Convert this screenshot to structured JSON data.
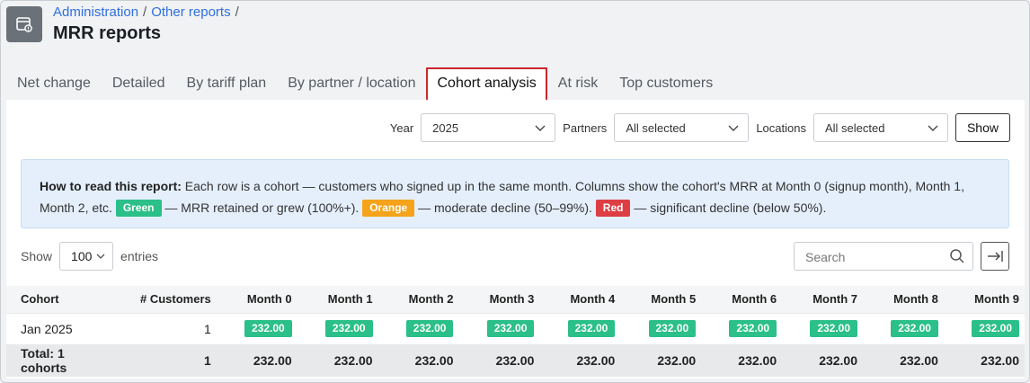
{
  "breadcrumb": {
    "items": [
      "Administration",
      "Other reports"
    ],
    "separator": "/"
  },
  "page_title": "MRR reports",
  "tabs": [
    {
      "label": "Net change"
    },
    {
      "label": "Detailed"
    },
    {
      "label": "By tariff plan"
    },
    {
      "label": "By partner / location"
    },
    {
      "label": "Cohort analysis",
      "active": true
    },
    {
      "label": "At risk"
    },
    {
      "label": "Top customers"
    }
  ],
  "filters": {
    "year_label": "Year",
    "year_value": "2025",
    "partners_label": "Partners",
    "partners_value": "All selected",
    "locations_label": "Locations",
    "locations_value": "All selected",
    "show_button": "Show"
  },
  "info": {
    "heading": "How to read this report:",
    "text1": " Each row is a cohort — customers who signed up in the same month. Columns show the cohort's MRR at Month 0 (signup month), Month 1, Month 2, etc. ",
    "green_badge": "Green",
    "text2": " — MRR retained or grew (100%+). ",
    "orange_badge": "Orange",
    "text3": " — moderate decline (50–99%). ",
    "red_badge": "Red",
    "text4": " — significant decline (below 50%)."
  },
  "table_controls": {
    "show_label": "Show",
    "page_length": "100",
    "entries_label": "entries",
    "search_placeholder": "Search"
  },
  "table": {
    "columns": [
      "Cohort",
      "# Customers",
      "Month 0",
      "Month 1",
      "Month 2",
      "Month 3",
      "Month 4",
      "Month 5",
      "Month 6",
      "Month 7",
      "Month 8",
      "Month 9"
    ],
    "rows": [
      {
        "cohort": "Jan 2025",
        "customers": "1",
        "months": [
          "232.00",
          "232.00",
          "232.00",
          "232.00",
          "232.00",
          "232.00",
          "232.00",
          "232.00",
          "232.00",
          "232.00"
        ]
      }
    ],
    "footer": {
      "label": "Total: 1 cohorts",
      "customers": "1",
      "months": [
        "232.00",
        "232.00",
        "232.00",
        "232.00",
        "232.00",
        "232.00",
        "232.00",
        "232.00",
        "232.00",
        "232.00"
      ]
    }
  },
  "colors": {
    "green": "#2bbf8a",
    "orange": "#f4a31b",
    "red": "#dc3e44",
    "link": "#2f6fde",
    "active_tab_border": "#c9272c"
  }
}
